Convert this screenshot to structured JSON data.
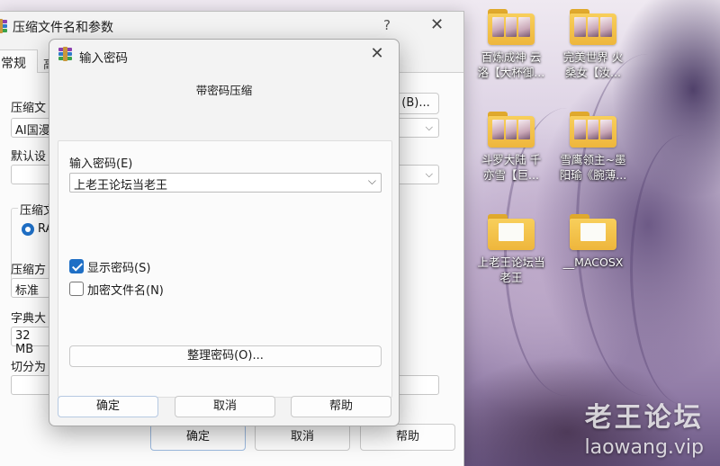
{
  "desktop": {
    "icons": [
      {
        "line1": "百炼成神  云",
        "line2": "洛【大杯御..."
      },
      {
        "line1": "完美世界  火",
        "line2": "桑女【汝..."
      },
      {
        "line1": "斗罗大陆  千",
        "line2": "亦雪【巨..."
      },
      {
        "line1": "雪鹰领主~墨",
        "line2": "阳瑜《腕薄..."
      },
      {
        "line1": "上老王论坛当",
        "line2": "老王"
      },
      {
        "line1": "__MACOSX",
        "line2": ""
      }
    ],
    "watermark": {
      "title": "老王论坛",
      "url": "laowang.vip"
    }
  },
  "back_window": {
    "title": "压缩文件名和参数",
    "help_symbol": "?",
    "close_symbol": "✕",
    "tabs": {
      "general": "常规",
      "advanced_partial": "高"
    },
    "archive_name_label": "压缩文",
    "archive_name_value": "AI国漫",
    "browse_button": "(B)...",
    "default_profile_label": "默认设",
    "archive_format_label": "压缩文",
    "format_option": "RA",
    "method_label": "压缩方",
    "method_value": "标准",
    "dict_label": "字典大",
    "dict_value": "32 MB",
    "split_label": "切分为",
    "ok_button": "确定",
    "cancel_button": "取消",
    "help_button": "帮助"
  },
  "dialog": {
    "title": "输入密码",
    "close_symbol": "✕",
    "heading": "带密码压缩",
    "password_label": "输入密码(E)",
    "password_value": "上老王论坛当老王",
    "show_password": {
      "label": "显示密码(S)",
      "checked": true
    },
    "encrypt_filenames": {
      "label": "加密文件名(N)",
      "checked": false
    },
    "organize_button": "整理密码(O)...",
    "ok_button": "确定",
    "cancel_button": "取消",
    "help_button": "帮助"
  }
}
